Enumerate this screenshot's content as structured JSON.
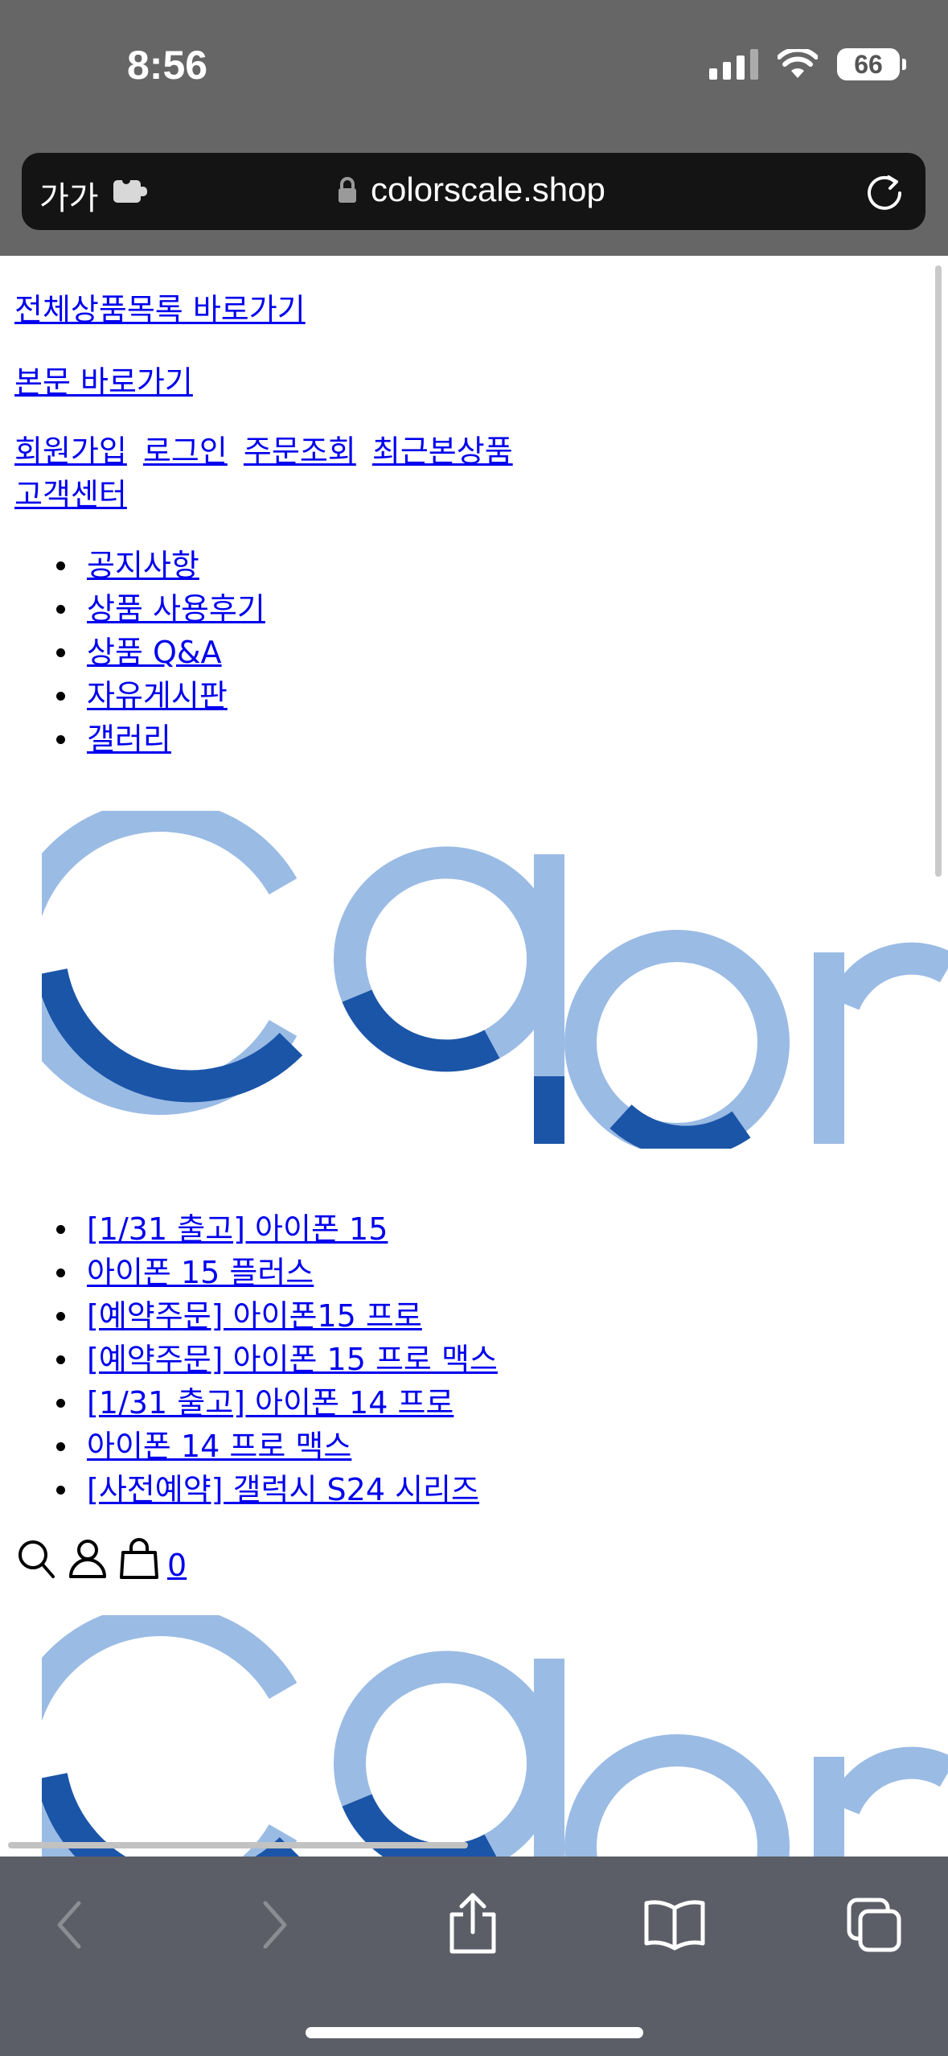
{
  "status": {
    "time": "8:56",
    "battery": "66"
  },
  "address_bar": {
    "aa_label": "가가",
    "url": "colorscale.shop"
  },
  "skip_links": {
    "all_products": "전체상품목록 바로가기",
    "main_content": "본문 바로가기"
  },
  "top_links": [
    "회원가입",
    "로그인",
    "주문조회",
    "최근본상품",
    "고객센터"
  ],
  "board_menu": [
    "공지사항",
    "상품 사용후기",
    "상품 Q&A",
    "자유게시판",
    "갤러리"
  ],
  "product_menu": [
    "[1/31 출고] 아이폰 15",
    "아이폰 15 플러스",
    "[예약주문] 아이폰15 프로",
    "[예약주문] 아이폰 15 프로 맥스",
    "[1/31 출고] 아이폰 14 프로",
    "아이폰 14 프로 맥스",
    "[사전예약] 갤럭시 S24 시리즈"
  ],
  "cart": {
    "count": "0"
  },
  "colors": {
    "logo_light": "#9abbe4",
    "logo_dark": "#1b55a8",
    "link": "#0000ee",
    "browser_chrome": "#666666",
    "toolbar": "#5b5e66"
  },
  "icons": {
    "toolbar": [
      "back-icon",
      "forward-icon",
      "share-icon",
      "bookmarks-icon",
      "tabs-icon"
    ],
    "header": [
      "search-icon",
      "user-icon",
      "cart-icon"
    ]
  }
}
